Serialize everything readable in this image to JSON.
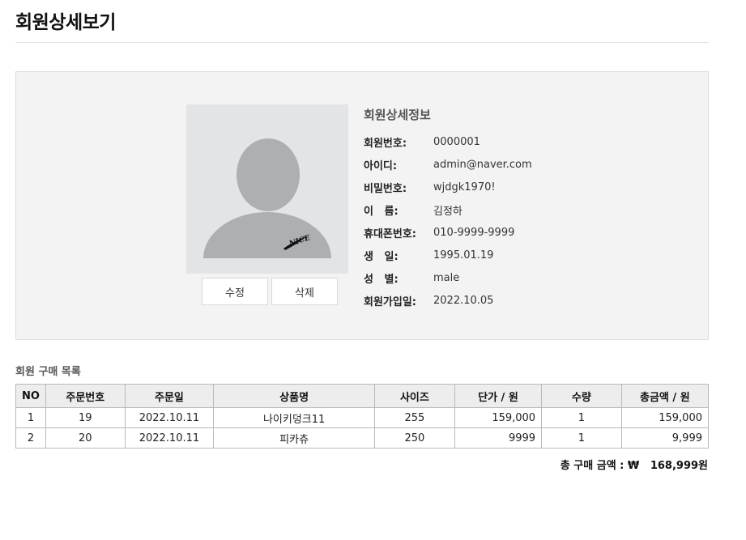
{
  "page": {
    "title": "회원상세보기"
  },
  "profile": {
    "section_title": "회원상세정보",
    "avatar_logo_text": "NICE",
    "edit_label": "수정",
    "delete_label": "삭제",
    "fields": [
      {
        "label": "회원번호:",
        "value": "0000001"
      },
      {
        "label": "아이디:",
        "value": "admin@naver.com"
      },
      {
        "label": "비밀번호:",
        "value": "wjdgk1970!"
      },
      {
        "label": "이   름:",
        "value": "김정하"
      },
      {
        "label": "휴대폰번호:",
        "value": "010-9999-9999"
      },
      {
        "label": "생   일:",
        "value": "1995.01.19"
      },
      {
        "label": "성   별:",
        "value": "male"
      },
      {
        "label": "회원가입일:",
        "value": "2022.10.05"
      }
    ]
  },
  "orders": {
    "section_title": "회원 구매 목록",
    "columns": [
      "NO",
      "주문번호",
      "주문일",
      "상품명",
      "사이즈",
      "단가 / 원",
      "수량",
      "총금액 / 원"
    ],
    "rows": [
      [
        "1",
        "19",
        "2022.10.11",
        "나이키덩크11",
        "255",
        "159,000",
        "1",
        "159,000"
      ],
      [
        "2",
        "20",
        "2022.10.11",
        "피카츄",
        "250",
        "9999",
        "1",
        "9,999"
      ]
    ],
    "total_label": "총 구매 금액 : ₩",
    "total_value": "168,999원"
  }
}
